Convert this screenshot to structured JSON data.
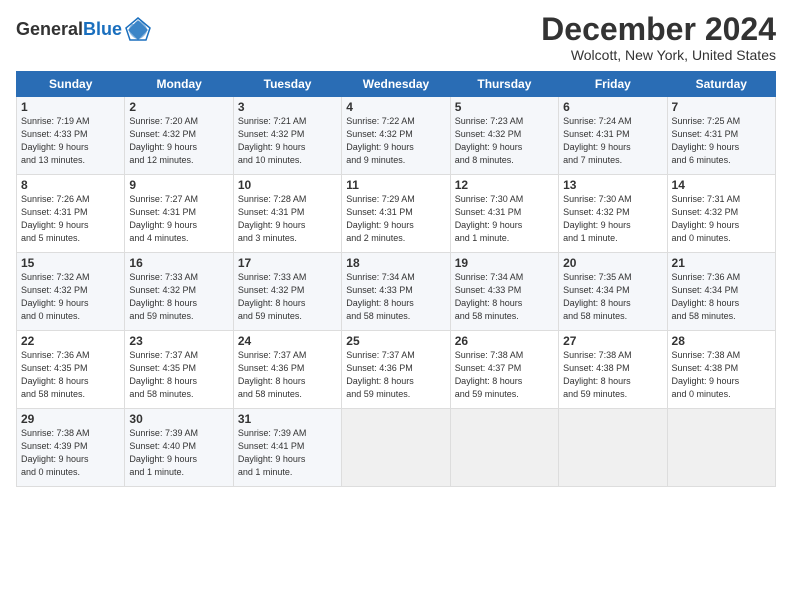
{
  "header": {
    "logo_general": "General",
    "logo_blue": "Blue",
    "month_title": "December 2024",
    "location": "Wolcott, New York, United States"
  },
  "days_of_week": [
    "Sunday",
    "Monday",
    "Tuesday",
    "Wednesday",
    "Thursday",
    "Friday",
    "Saturday"
  ],
  "weeks": [
    [
      {
        "day": "1",
        "info": "Sunrise: 7:19 AM\nSunset: 4:33 PM\nDaylight: 9 hours\nand 13 minutes."
      },
      {
        "day": "2",
        "info": "Sunrise: 7:20 AM\nSunset: 4:32 PM\nDaylight: 9 hours\nand 12 minutes."
      },
      {
        "day": "3",
        "info": "Sunrise: 7:21 AM\nSunset: 4:32 PM\nDaylight: 9 hours\nand 10 minutes."
      },
      {
        "day": "4",
        "info": "Sunrise: 7:22 AM\nSunset: 4:32 PM\nDaylight: 9 hours\nand 9 minutes."
      },
      {
        "day": "5",
        "info": "Sunrise: 7:23 AM\nSunset: 4:32 PM\nDaylight: 9 hours\nand 8 minutes."
      },
      {
        "day": "6",
        "info": "Sunrise: 7:24 AM\nSunset: 4:31 PM\nDaylight: 9 hours\nand 7 minutes."
      },
      {
        "day": "7",
        "info": "Sunrise: 7:25 AM\nSunset: 4:31 PM\nDaylight: 9 hours\nand 6 minutes."
      }
    ],
    [
      {
        "day": "8",
        "info": "Sunrise: 7:26 AM\nSunset: 4:31 PM\nDaylight: 9 hours\nand 5 minutes."
      },
      {
        "day": "9",
        "info": "Sunrise: 7:27 AM\nSunset: 4:31 PM\nDaylight: 9 hours\nand 4 minutes."
      },
      {
        "day": "10",
        "info": "Sunrise: 7:28 AM\nSunset: 4:31 PM\nDaylight: 9 hours\nand 3 minutes."
      },
      {
        "day": "11",
        "info": "Sunrise: 7:29 AM\nSunset: 4:31 PM\nDaylight: 9 hours\nand 2 minutes."
      },
      {
        "day": "12",
        "info": "Sunrise: 7:30 AM\nSunset: 4:31 PM\nDaylight: 9 hours\nand 1 minute."
      },
      {
        "day": "13",
        "info": "Sunrise: 7:30 AM\nSunset: 4:32 PM\nDaylight: 9 hours\nand 1 minute."
      },
      {
        "day": "14",
        "info": "Sunrise: 7:31 AM\nSunset: 4:32 PM\nDaylight: 9 hours\nand 0 minutes."
      }
    ],
    [
      {
        "day": "15",
        "info": "Sunrise: 7:32 AM\nSunset: 4:32 PM\nDaylight: 9 hours\nand 0 minutes."
      },
      {
        "day": "16",
        "info": "Sunrise: 7:33 AM\nSunset: 4:32 PM\nDaylight: 8 hours\nand 59 minutes."
      },
      {
        "day": "17",
        "info": "Sunrise: 7:33 AM\nSunset: 4:32 PM\nDaylight: 8 hours\nand 59 minutes."
      },
      {
        "day": "18",
        "info": "Sunrise: 7:34 AM\nSunset: 4:33 PM\nDaylight: 8 hours\nand 58 minutes."
      },
      {
        "day": "19",
        "info": "Sunrise: 7:34 AM\nSunset: 4:33 PM\nDaylight: 8 hours\nand 58 minutes."
      },
      {
        "day": "20",
        "info": "Sunrise: 7:35 AM\nSunset: 4:34 PM\nDaylight: 8 hours\nand 58 minutes."
      },
      {
        "day": "21",
        "info": "Sunrise: 7:36 AM\nSunset: 4:34 PM\nDaylight: 8 hours\nand 58 minutes."
      }
    ],
    [
      {
        "day": "22",
        "info": "Sunrise: 7:36 AM\nSunset: 4:35 PM\nDaylight: 8 hours\nand 58 minutes."
      },
      {
        "day": "23",
        "info": "Sunrise: 7:37 AM\nSunset: 4:35 PM\nDaylight: 8 hours\nand 58 minutes."
      },
      {
        "day": "24",
        "info": "Sunrise: 7:37 AM\nSunset: 4:36 PM\nDaylight: 8 hours\nand 58 minutes."
      },
      {
        "day": "25",
        "info": "Sunrise: 7:37 AM\nSunset: 4:36 PM\nDaylight: 8 hours\nand 59 minutes."
      },
      {
        "day": "26",
        "info": "Sunrise: 7:38 AM\nSunset: 4:37 PM\nDaylight: 8 hours\nand 59 minutes."
      },
      {
        "day": "27",
        "info": "Sunrise: 7:38 AM\nSunset: 4:38 PM\nDaylight: 8 hours\nand 59 minutes."
      },
      {
        "day": "28",
        "info": "Sunrise: 7:38 AM\nSunset: 4:38 PM\nDaylight: 9 hours\nand 0 minutes."
      }
    ],
    [
      {
        "day": "29",
        "info": "Sunrise: 7:38 AM\nSunset: 4:39 PM\nDaylight: 9 hours\nand 0 minutes."
      },
      {
        "day": "30",
        "info": "Sunrise: 7:39 AM\nSunset: 4:40 PM\nDaylight: 9 hours\nand 1 minute."
      },
      {
        "day": "31",
        "info": "Sunrise: 7:39 AM\nSunset: 4:41 PM\nDaylight: 9 hours\nand 1 minute."
      },
      null,
      null,
      null,
      null
    ]
  ]
}
